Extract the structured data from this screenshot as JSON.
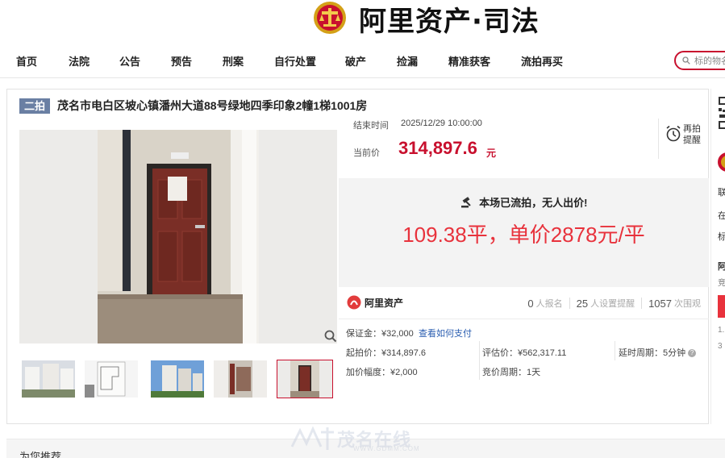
{
  "header": {
    "brand": "阿里资产·司法"
  },
  "nav": {
    "items": [
      "首页",
      "法院",
      "公告",
      "预告",
      "刑案",
      "自行处置",
      "破产",
      "捡漏",
      "精准获客",
      "流拍再买"
    ],
    "search_placeholder": "标的物名"
  },
  "lot": {
    "round_badge": "二拍",
    "title": "茂名市电白区坡心镇潘州大道88号绿地四季印象2幢1梯1001房",
    "end_time_label": "结束时间",
    "end_time": "2025/12/29 10:00:00",
    "current_price_label": "当前价",
    "current_price": "314,897.6",
    "currency_unit": "元",
    "remind_label_1": "再拍",
    "remind_label_2": "提醒",
    "status": "本场已流拍，无人出价!",
    "overlay_note": "109.38平，单价2878元/平"
  },
  "org": {
    "name": "阿里资产",
    "signups": "0",
    "signups_label": "人报名",
    "reminders": "25",
    "reminders_label": "人设置提醒",
    "views": "1057",
    "views_label": "次围观"
  },
  "details": {
    "deposit": "保证金：¥32,000",
    "pay_link": "查看如何支付",
    "start_price": "起拍价：¥314,897.6",
    "appraisal": "评估价：¥562,317.11",
    "delay": "延时周期：5分钟",
    "increment": "加价幅度：¥2,000",
    "cycle": "竞价周期：1天"
  },
  "sidebar": {
    "items": [
      "联",
      "在",
      "标",
      "阿",
      "竞",
      "1.",
      "3"
    ]
  },
  "recommend": {
    "title": "为您推荐"
  },
  "watermark": {
    "text": "茂名在线",
    "url": "WWW.GDMM.COM"
  },
  "colors": {
    "accent": "#c8102e",
    "note_red": "#e8323c",
    "badge": "#6a7fa3"
  }
}
